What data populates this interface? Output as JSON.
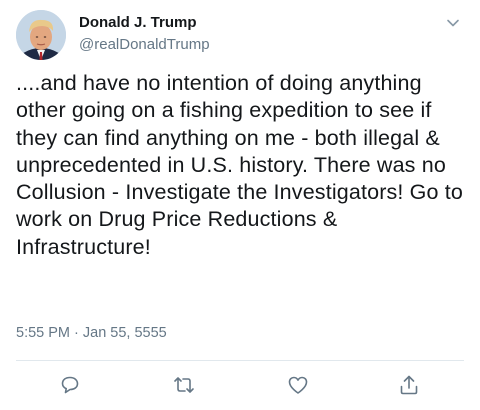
{
  "author": {
    "name": "Donald J. Trump",
    "handle": "@realDonaldTrump"
  },
  "tweet": {
    "text": "....and have no intention of doing anything other going on a fishing expedition to see if they can find anything on me - both illegal & unprecedented in U.S. history. There was no Collusion - Investigate the Investigators! Go to work on Drug Price Reductions & Infrastructure!",
    "timestamp": "5:55 PM · Jan 55, 5555"
  },
  "icons": {
    "menu": "chevron-down-icon",
    "reply": "reply-icon",
    "retweet": "retweet-icon",
    "like": "heart-icon",
    "share": "share-icon"
  },
  "colors": {
    "text": "#14171a",
    "secondary": "#657786",
    "divider": "#e1e8ed"
  }
}
